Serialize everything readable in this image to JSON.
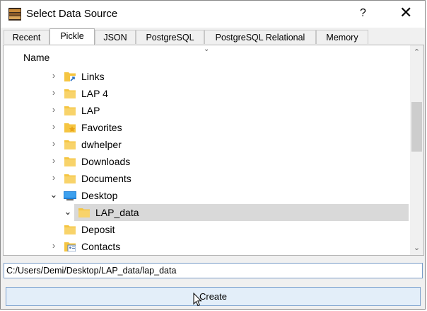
{
  "window": {
    "title": "Select Data Source",
    "help_label": "?",
    "close_label": "✕"
  },
  "tabs": [
    {
      "label": "Recent",
      "active": false
    },
    {
      "label": "Pickle",
      "active": true
    },
    {
      "label": "JSON",
      "active": false
    },
    {
      "label": "PostgreSQL",
      "active": false
    },
    {
      "label": "PostgreSQL Relational",
      "active": false
    },
    {
      "label": "Memory",
      "active": false
    }
  ],
  "tree": {
    "column_header": "Name",
    "items": [
      {
        "label": "Links",
        "expander": "collapsed",
        "icon": "links-folder-icon",
        "selected": false
      },
      {
        "label": "LAP 4",
        "expander": "collapsed",
        "icon": "folder-icon",
        "selected": false
      },
      {
        "label": "LAP",
        "expander": "collapsed",
        "icon": "folder-icon",
        "selected": false
      },
      {
        "label": "Favorites",
        "expander": "collapsed",
        "icon": "favorites-folder-icon",
        "selected": false
      },
      {
        "label": "dwhelper",
        "expander": "collapsed",
        "icon": "folder-icon",
        "selected": false
      },
      {
        "label": "Downloads",
        "expander": "collapsed",
        "icon": "folder-icon",
        "selected": false
      },
      {
        "label": "Documents",
        "expander": "collapsed",
        "icon": "folder-icon",
        "selected": false
      },
      {
        "label": "Desktop",
        "expander": "expanded",
        "icon": "desktop-icon",
        "selected": false
      },
      {
        "label": "LAP_data",
        "expander": "expanded",
        "icon": "folder-icon",
        "selected": true
      },
      {
        "label": "Deposit",
        "expander": "none",
        "icon": "folder-icon",
        "selected": false
      },
      {
        "label": "Contacts",
        "expander": "collapsed",
        "icon": "contacts-folder-icon",
        "selected": false
      }
    ]
  },
  "path_field": {
    "value": "C:/Users/Demi/Desktop/LAP_data/lap_data"
  },
  "create_button": {
    "label": "Create"
  },
  "colors": {
    "folder": "#f5c542",
    "selection": "#d9d9d9",
    "button_bg": "#e3eef9",
    "button_border": "#7da2ce"
  }
}
